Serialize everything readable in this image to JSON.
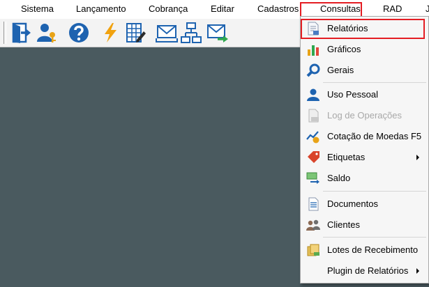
{
  "menubar": {
    "items": [
      "Sistema",
      "Lançamento",
      "Cobrança",
      "Editar",
      "Cadastros",
      "Consultas",
      "RAD",
      "J"
    ],
    "active": "Consultas"
  },
  "toolbar": {
    "buttons": [
      "logout-icon",
      "user-key-icon",
      "help-icon",
      "lightning-icon",
      "ledger-edit-icon",
      "envelope-tray-icon",
      "org-chart-icon",
      "envelope-send-icon"
    ]
  },
  "consultas_menu": {
    "items": [
      {
        "label": "Relatórios",
        "icon": "report-icon",
        "highlighted": true
      },
      {
        "label": "Gráficos",
        "icon": "bar-chart-icon"
      },
      {
        "label": "Gerais",
        "icon": "magnifier-icon"
      },
      {
        "label": "Uso Pessoal",
        "icon": "person-icon"
      },
      {
        "label": "Log de Operações",
        "icon": "log-document-icon",
        "disabled": true
      },
      {
        "label": "Cotação de Moedas F5",
        "icon": "currency-chart-icon"
      },
      {
        "label": "Etiquetas",
        "icon": "label-tag-icon",
        "submenu": true
      },
      {
        "label": "Saldo",
        "icon": "money-transfer-icon"
      },
      {
        "label": "Documentos",
        "icon": "document-icon"
      },
      {
        "label": "Clientes",
        "icon": "clients-icon"
      },
      {
        "label": "Lotes de Recebimento",
        "icon": "receipt-batch-icon"
      },
      {
        "label": "Plugin de Relatórios",
        "icon": "",
        "submenu": true
      }
    ]
  },
  "colors": {
    "workspace": "#4a5a5f",
    "highlight_border": "#e41d23"
  }
}
